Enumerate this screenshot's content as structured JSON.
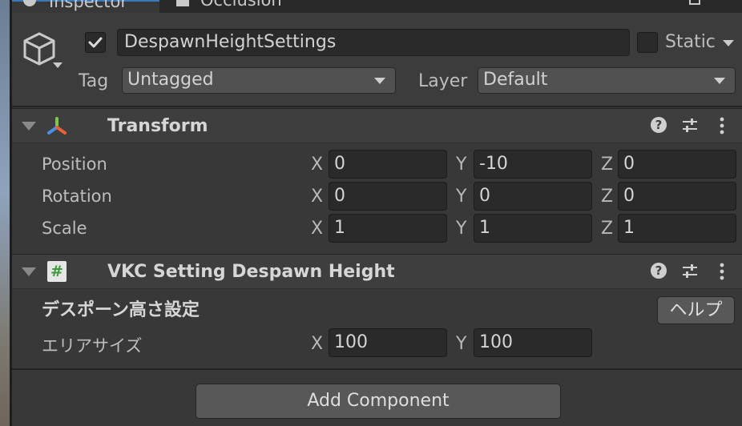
{
  "tabs": [
    {
      "label": "Inspector"
    },
    {
      "label": "Occlusion"
    }
  ],
  "header": {
    "object_name": "DespawnHeightSettings",
    "static_label": "Static",
    "tag_label": "Tag",
    "tag_value": "Untagged",
    "layer_label": "Layer",
    "layer_value": "Default"
  },
  "transform": {
    "title": "Transform",
    "rows": [
      {
        "label": "Position",
        "x": "0",
        "y": "-10",
        "z": "0"
      },
      {
        "label": "Rotation",
        "x": "0",
        "y": "0",
        "z": "0"
      },
      {
        "label": "Scale",
        "x": "1",
        "y": "1",
        "z": "1"
      }
    ]
  },
  "axis_labels": {
    "x": "X",
    "y": "Y",
    "z": "Z"
  },
  "vkc": {
    "title": "VKC Setting Despawn Height",
    "section_title": "デスポーン高さ設定",
    "help_label": "ヘルプ",
    "area_label": "エリアサイズ",
    "area_x": "100",
    "area_y": "100"
  },
  "add_component_label": "Add Component",
  "colors": {
    "accent": "#3a79bb",
    "panel": "#383838",
    "field": "#2a2a2a",
    "script_icon": "#4fb34f"
  }
}
